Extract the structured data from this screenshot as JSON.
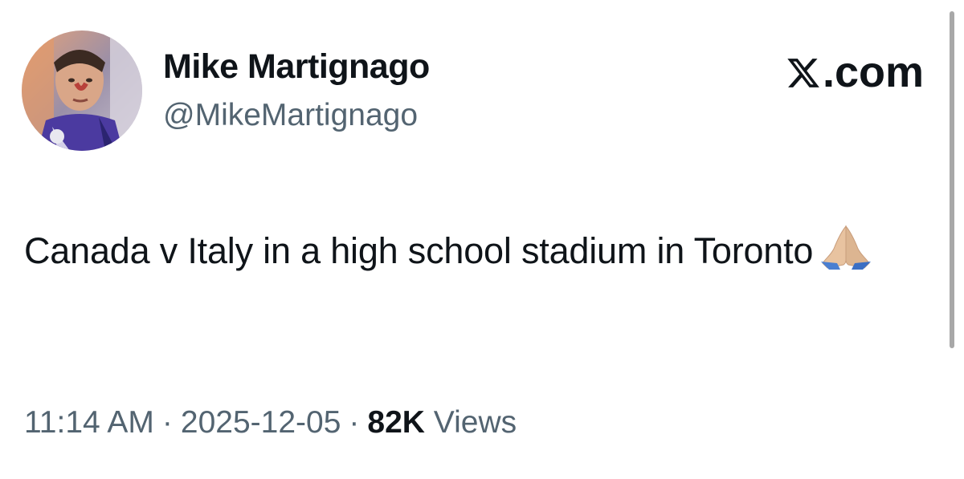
{
  "author": {
    "display_name": "Mike Martignago",
    "handle": "@MikeMartignago",
    "avatar_icon": "profile-photo"
  },
  "brand": {
    "logo_icon": "x-logo-icon",
    "suffix": ".com"
  },
  "tweet": {
    "text": "Canada v Italy in a high school stadium in Toronto",
    "emoji": "folded-hands-emoji"
  },
  "meta": {
    "time": "11:14 AM",
    "separator": "·",
    "date": "2025-12-05",
    "views_count": "82K",
    "views_label": "Views"
  },
  "colors": {
    "text_primary": "#0f1419",
    "text_secondary": "#536471"
  }
}
